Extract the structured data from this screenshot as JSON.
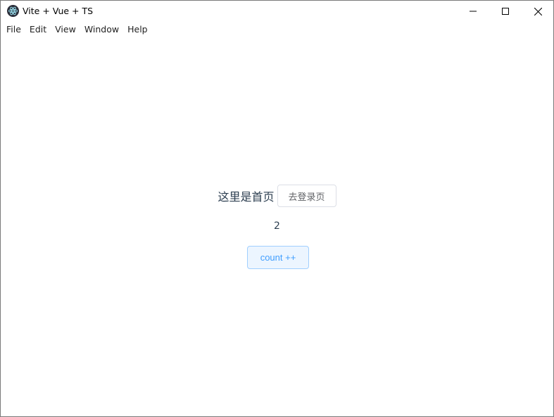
{
  "window": {
    "title": "Vite + Vue + TS",
    "icon": "electron-icon"
  },
  "menubar": {
    "items": [
      {
        "label": "File"
      },
      {
        "label": "Edit"
      },
      {
        "label": "View"
      },
      {
        "label": "Window"
      },
      {
        "label": "Help"
      }
    ]
  },
  "main": {
    "home_text": "这里是首页",
    "login_button_label": "去登录页",
    "count_value": "2",
    "count_button_label": "count ++"
  },
  "colors": {
    "text": "#2c3e50",
    "primary": "#409eff",
    "primary_light_bg": "#ecf5ff",
    "primary_border": "#a0cfff",
    "default_border": "#dcdfe6",
    "default_text": "#606266"
  }
}
